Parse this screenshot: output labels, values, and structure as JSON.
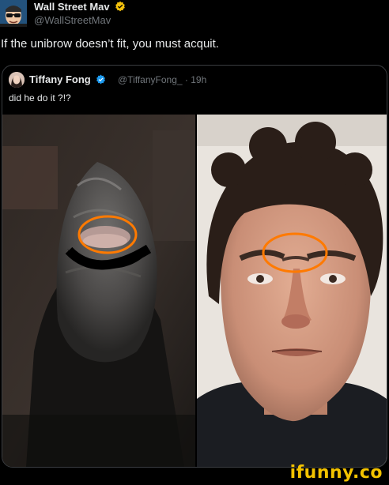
{
  "author": {
    "name": "Wall Street Mav",
    "handle": "@WallStreetMav",
    "avatar_icon": "sunglasses-avatar-icon",
    "verified_icon": "gold-verified-badge-icon"
  },
  "tweet": {
    "text": "If the unibrow doesn’t fit, you must acquit."
  },
  "quoted_tweet": {
    "name": "Tiffany Fong",
    "handle_time": "@TiffanyFong_ · 19h",
    "text": "did he do it ?!?",
    "verified_icon": "blue-verified-badge-icon",
    "photos": [
      "hooded-masked-figure-photo",
      "man-face-photo"
    ]
  },
  "watermark": {
    "text": "ifunny.co",
    "color": "#f2c200"
  },
  "colors": {
    "background": "#000000",
    "text_primary": "#e7e9ea",
    "text_secondary": "#71767b",
    "verified_gold": "#f4c20d",
    "verified_blue": "#1d9bf0",
    "annotation_circle": "#ff7a00"
  }
}
